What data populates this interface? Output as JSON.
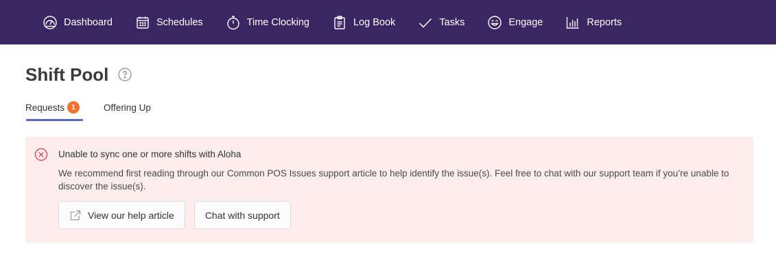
{
  "nav": {
    "items": [
      {
        "label": "Dashboard",
        "icon": "dashboard-gauge-icon"
      },
      {
        "label": "Schedules",
        "icon": "calendar-icon"
      },
      {
        "label": "Time Clocking",
        "icon": "stopwatch-icon"
      },
      {
        "label": "Log Book",
        "icon": "clipboard-icon"
      },
      {
        "label": "Tasks",
        "icon": "checkmark-icon"
      },
      {
        "label": "Engage",
        "icon": "smiley-icon"
      },
      {
        "label": "Reports",
        "icon": "bar-chart-icon"
      }
    ]
  },
  "page": {
    "title": "Shift Pool",
    "help_icon": "question-circle-icon"
  },
  "tabs": [
    {
      "label": "Requests",
      "badge": "1",
      "active": true
    },
    {
      "label": "Offering Up",
      "active": false
    }
  ],
  "alert": {
    "icon": "error-x-circle-icon",
    "title": "Unable to sync one or more shifts with Aloha",
    "body": "We recommend first reading through our Common POS Issues support article to help identify the issue(s). Feel free to chat with our support team if you’re unable to discover the issue(s).",
    "help_button": "View our help article",
    "help_button_icon": "external-link-icon",
    "support_button": "Chat with support"
  },
  "colors": {
    "nav_bg": "#3b2663",
    "accent": "#5665c7",
    "badge": "#f0712c",
    "alert_bg": "#fdeded",
    "error": "#e0414d"
  }
}
